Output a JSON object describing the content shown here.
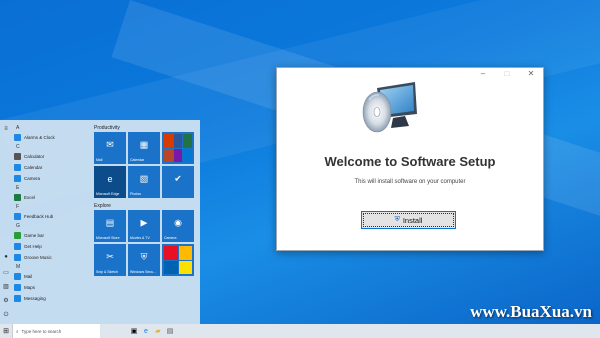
{
  "setup_window": {
    "title": "",
    "welcome": "Welcome to Software Setup",
    "subtitle": "This will install software on your computer",
    "install_label": "Install",
    "caption_minimize": "–",
    "caption_maximize": "□",
    "caption_close": "✕"
  },
  "start_menu": {
    "letters": [
      "A",
      "C",
      "E",
      "F",
      "G",
      "M"
    ],
    "apps": [
      {
        "letter_index": 0,
        "name": "Alarms & Clock",
        "color": "#1e88e5"
      },
      {
        "letter_index": 1,
        "name": "Calculator",
        "color": "#555555"
      },
      {
        "letter_index": 1,
        "name": "Calendar",
        "color": "#1e88e5"
      },
      {
        "letter_index": 1,
        "name": "Camera",
        "color": "#1e88e5"
      },
      {
        "letter_index": 2,
        "name": "Excel",
        "color": "#1d7a3f"
      },
      {
        "letter_index": 3,
        "name": "Feedback Hub",
        "color": "#1e88e5"
      },
      {
        "letter_index": 4,
        "name": "Game bar",
        "color": "#2a9d3b"
      },
      {
        "letter_index": 4,
        "name": "Get Help",
        "color": "#1e88e5"
      },
      {
        "letter_index": 4,
        "name": "Groove Music",
        "color": "#1e88e5"
      },
      {
        "letter_index": 5,
        "name": "Mail",
        "color": "#1e88e5"
      },
      {
        "letter_index": 5,
        "name": "Maps",
        "color": "#1e88e5"
      },
      {
        "letter_index": 5,
        "name": "Messaging",
        "color": "#1e88e5"
      }
    ],
    "groups": [
      {
        "title": "Productivity",
        "tiles": [
          {
            "label": "Mail",
            "icon": "✉",
            "style": "blue"
          },
          {
            "label": "Calendar",
            "icon": "▦",
            "style": "blue"
          },
          {
            "label": "",
            "icon": "",
            "style": "office"
          },
          {
            "label": "Microsoft Edge",
            "icon": "e",
            "style": "dark"
          },
          {
            "label": "Photos",
            "icon": "▧",
            "style": "blue"
          },
          {
            "label": "",
            "icon": "✔",
            "style": "blue"
          }
        ]
      },
      {
        "title": "Explore",
        "tiles": [
          {
            "label": "Microsoft Store",
            "icon": "▤",
            "style": "blue"
          },
          {
            "label": "Movies & TV",
            "icon": "▶",
            "style": "blue"
          },
          {
            "label": "Camera",
            "icon": "◉",
            "style": "blue"
          },
          {
            "label": "Snip & Sketch",
            "icon": "✂",
            "style": "blue"
          },
          {
            "label": "Windows Secu...",
            "icon": "⛨",
            "style": "blue"
          },
          {
            "label": "",
            "icon": "",
            "style": "split"
          }
        ]
      }
    ]
  },
  "taskbar": {
    "search_placeholder": "Type here to search",
    "icons": [
      "task-view-icon",
      "edge-icon",
      "explorer-icon",
      "store-icon"
    ]
  },
  "watermark": "www.BuaXua.vn",
  "colors": {
    "desktop": "#0b79dc",
    "tile": "#1a73c8",
    "accent": "#0a74d6"
  }
}
